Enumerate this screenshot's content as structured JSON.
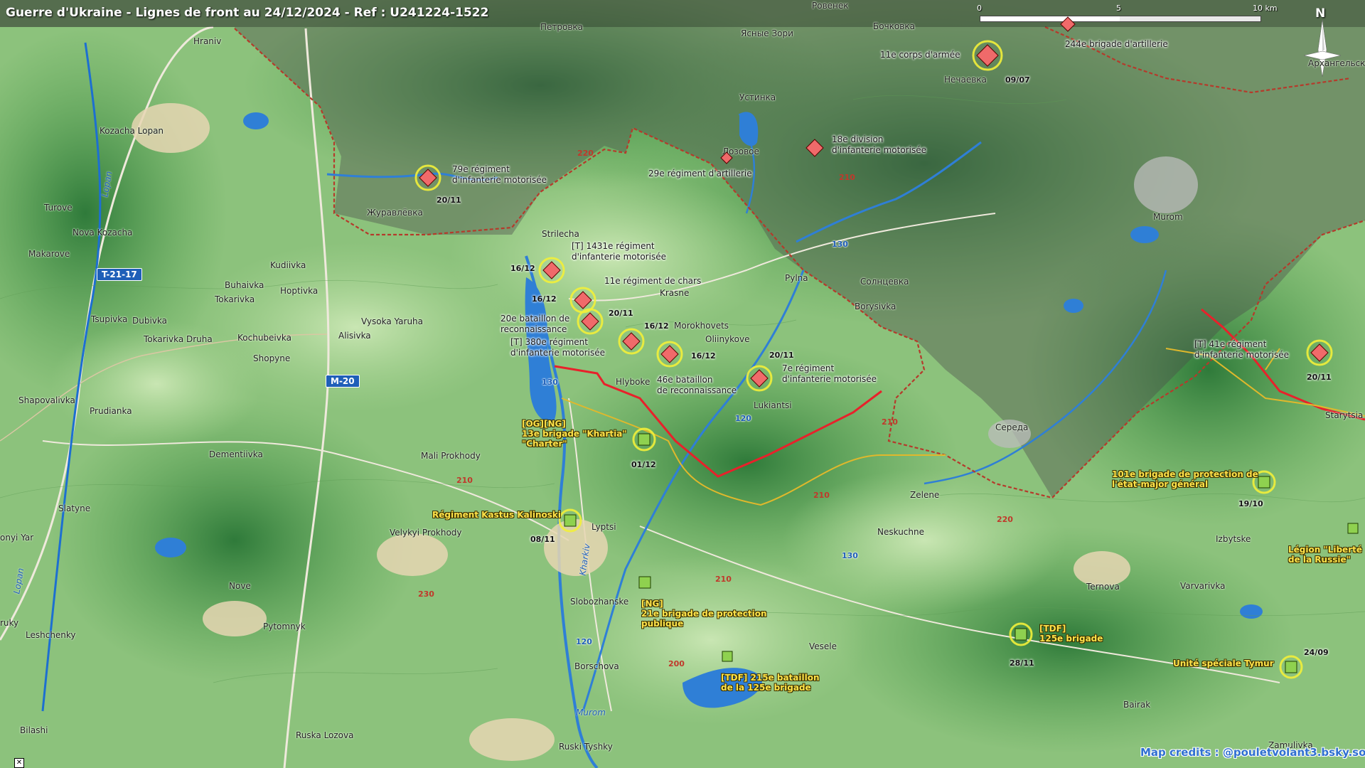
{
  "title": "Guerre d'Ukraine - Lignes de front au 24/12/2024 - Ref : U241224-1522",
  "scale": {
    "zero": "0",
    "mid": "5",
    "end": "10 km"
  },
  "north": "N",
  "credits": "Map credits : @pouletvolant3.bsky.social",
  "colors": {
    "frontline": "#e8212b",
    "border": "#c0392b",
    "russian_unit": "#f06a6a",
    "ukrainian_unit": "#8fd14f",
    "unit_halo": "#f2f03a",
    "water": "#2f7fd6",
    "occupied_shade": "#555555"
  },
  "places": {
    "rovenek": "Ровенек",
    "bochkovka": "Бочковка",
    "petrovka": "Петровка",
    "yasnye": "Ясные Зори",
    "hraniv": "Hraniv",
    "nechaevka": "Нечаевка",
    "arkhangel": "Архангельское",
    "ustinka": "Устинка",
    "lozovoe": "Лозовое",
    "kozacha": "Kozacha Lopan",
    "zhuravlevka": "Журавлёвка",
    "turove": "Turove",
    "novakozacha": "Nova Kozacha",
    "murom_n": "Murom",
    "makarove": "Makarove",
    "strilecha": "Strilecha",
    "kudiivka": "Kudiivka",
    "buhaivka": "Buhaivka",
    "hoptivka": "Hoptivka",
    "tokarivka": "Tokarivka",
    "krasne": "Krasne",
    "pylna": "Pylna",
    "solntsevka": "Солнцевка",
    "borysivka": "Borysivka",
    "tsupivka": "Tsupivka",
    "dubivka": "Dubivka",
    "vysoka": "Vysoka Yaruha",
    "morokhovets": "Morokhovets",
    "oliinykove": "Oliinykove",
    "tokdruha": "Tokarivka Druha",
    "kochubeivka": "Kochubeivka",
    "alisivka": "Alisivka",
    "shopyne": "Shopyne",
    "hlyboke": "Hlyboke",
    "lukiantsi": "Lukiantsi",
    "shapovalivka": "Shapovalivka",
    "prudianka": "Prudianka",
    "sereda": "Середа",
    "starytsia": "Starytsia",
    "dementiivka": "Dementiivka",
    "maliprokhody": "Mali Prokhody",
    "slatyne": "Slatyne",
    "zelene": "Zelene",
    "neskuchne": "Neskuchne",
    "lyptsi": "Lyptsi",
    "velykiprokhody": "Velykyi Prokhody",
    "izbytske": "Izbytske",
    "ternova": "Ternova",
    "varvarivka": "Varvarivka",
    "onyiyar": "onyi Yar",
    "nove": "Nove",
    "slobozhanske": "Slobozhanske",
    "uky": "ruky",
    "leshchenky": "Leshchenky",
    "pytomnyk": "Pytomnyk",
    "vesele": "Vesele",
    "borschova": "Borschova",
    "bairak": "Bairak",
    "bilashi": "Bilashi",
    "ruskalozova": "Ruska Lozova",
    "ruskityshky": "Ruski Tyshky",
    "zamulivka": "Zamulivka"
  },
  "rivers": {
    "lopan": "Lopan",
    "kharkiv": "Kharkiv",
    "murom": "Murom",
    "lopan2": "Lopan"
  },
  "roads": {
    "r220a": "220",
    "r210a": "210",
    "r130a": "130",
    "r130b": "130",
    "r120a": "120",
    "r210b": "210",
    "r210c": "210",
    "r210d": "210",
    "r220b": "220",
    "r130c": "130",
    "r210e": "210",
    "r230": "230",
    "r120b": "120",
    "r200": "200"
  },
  "shields": {
    "t2117": "T-21-17",
    "m20": "M-20"
  },
  "units": {
    "ru_11corps": {
      "label": "11e corps d'armée",
      "date": "09/07"
    },
    "ru_244": {
      "label": "244e brigade d'artillerie"
    },
    "ru_18div": {
      "label1": "18e division",
      "label2": "d'infanterie motorisée"
    },
    "ru_29art": {
      "label": "29e régiment d'artillerie"
    },
    "ru_79": {
      "label1": "79e régiment",
      "label2": "d'infanterie motorisée",
      "date": "20/11"
    },
    "ru_1431": {
      "label1": "[T] 1431e régiment",
      "label2": "d'infanterie motorisée",
      "date": "16/12"
    },
    "ru_11chars": {
      "label": "11e régiment de chars",
      "date": "16/12"
    },
    "ru_20rec": {
      "label1": "20e bataillon de",
      "label2": "reconnaissance",
      "date": "20/11"
    },
    "ru_380": {
      "label1": "[T] 380e régiment",
      "label2": "d'infanterie motorisée",
      "date": "16/12"
    },
    "ru_46rec": {
      "label1": "46e bataillon",
      "label2": "de reconnaissance",
      "date": "16/12"
    },
    "ru_7": {
      "label1": "7e régiment",
      "label2": "d'infanterie motorisée",
      "date": "20/11"
    },
    "ru_41": {
      "label1": "[T] 41e régiment",
      "label2": "d'infanterie motorisée",
      "date": "20/11"
    },
    "ua_13": {
      "label1": "[OG][NG]",
      "label2": "13e brigade \"Khartia\"",
      "label3": "\"Charter\"",
      "date": "01/12"
    },
    "ua_kalinoski": {
      "label": "Régiment Kastus Kalinoski",
      "date": "08/11"
    },
    "ua_101": {
      "label1": "101e brigade de protection de",
      "label2": "l'état-major général",
      "date": "19/10"
    },
    "ua_legion": {
      "label1": "Légion \"Liberté",
      "label2": "de la Russie\""
    },
    "ua_21": {
      "label1": "[NG]",
      "label2": "21e brigade de protection",
      "label3": "publique"
    },
    "ua_125": {
      "label1": "[TDF]",
      "label2": "125e brigade",
      "date": "28/11"
    },
    "ua_215": {
      "label1": "[TDF] 215e bataillon",
      "label2": "de la 125e brigade"
    },
    "ua_tymur": {
      "label": "Unité spéciale Tymur",
      "date": "24/09"
    }
  }
}
